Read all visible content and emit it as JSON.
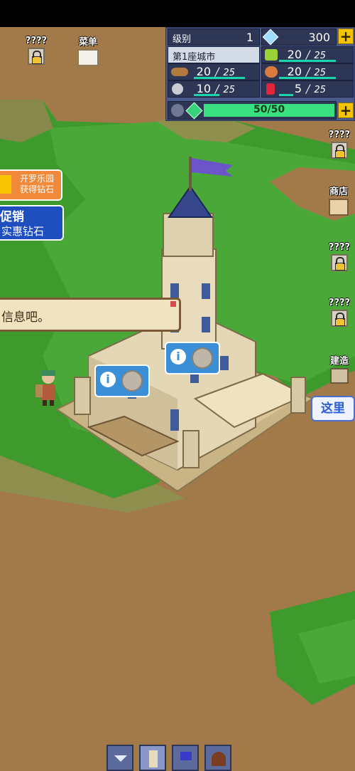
{
  "top_left": {
    "locked_label": "????",
    "menu_label": "菜单"
  },
  "stats": {
    "level_label": "级别",
    "level_value": "1",
    "gems_value": "300",
    "city_name": "第1座城市",
    "resources": [
      {
        "icon": "log-icon",
        "current": "20",
        "max": "25",
        "fill": 0.8
      },
      {
        "icon": "crop-icon",
        "current": "20",
        "max": "25",
        "fill": 0.8
      },
      {
        "icon": "vegetable-icon",
        "current": "20",
        "max": "25",
        "fill": 0.8
      },
      {
        "icon": "stone-icon",
        "current": "10",
        "max": "25",
        "fill": 0.4
      },
      {
        "icon": "red-gem-icon",
        "current": "5",
        "max": "25",
        "fill": 0.2
      }
    ],
    "energy_value": "50/50",
    "energy_fill": 1.0
  },
  "left_banners": {
    "game_link": "开罗乐园\n获得钻石",
    "promo_title": "促销",
    "promo_sub": "实惠钻石"
  },
  "message": {
    "text": "信息吧。"
  },
  "right_menu": {
    "locked_1": "????",
    "shop": "商店",
    "locked_2": "????",
    "locked_3": "????",
    "build": "建造",
    "build_here": "这里"
  },
  "colors": {
    "grass": "#3f9a2e",
    "dirt": "#a27a4a",
    "panel": "#4a5a8a",
    "accent_green": "#1bd4a9",
    "info_blue": "#3b8fd6"
  }
}
